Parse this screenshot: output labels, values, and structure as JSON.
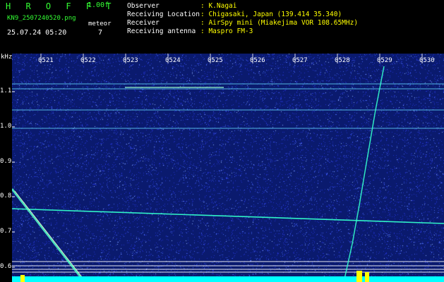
{
  "header": {
    "app_title": "H R O F F T",
    "version": "1.00f",
    "filename": "KN9_2507240520.png",
    "meteor_label": "meteor",
    "meteor_count": "7",
    "datetime": "25.07.24 05:20"
  },
  "info": [
    {
      "key": "Observer",
      "value": ": K.Nagai"
    },
    {
      "key": "Receiving Location",
      "value": ": Chigasaki, Japan (139.414 35.340)"
    },
    {
      "key": "Receiver",
      "value": ": AirSpy mini (Miakejima VOR 108.65MHz)"
    },
    {
      "key": "Receiving antenna",
      "value": ": Maspro FM-3"
    }
  ],
  "y_axis": {
    "unit": "kHz",
    "ticks": [
      "1.1",
      "1.0",
      "0.9",
      "0.8",
      "0.7",
      "0.6"
    ]
  },
  "x_axis": {
    "ticks": [
      "0521",
      "0522",
      "0523",
      "0524",
      "0525",
      "0526",
      "0527",
      "0528",
      "0529",
      "0530"
    ]
  },
  "colors": {
    "background": "#0a1a6e",
    "noise_blue": "#2233cc",
    "noise_light": "#88aaff",
    "trace_cyan": "#00ffff",
    "label_green": "#33ff33",
    "label_yellow": "#ffff00"
  }
}
